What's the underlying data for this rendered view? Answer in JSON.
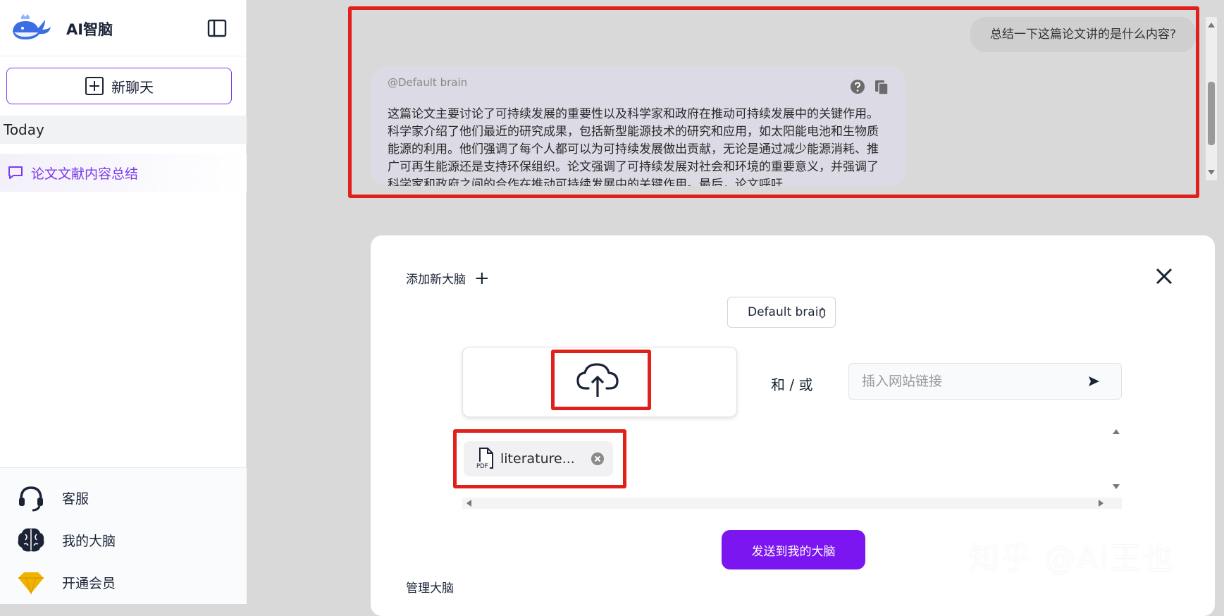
{
  "sidebar": {
    "app_name": "AI智脑",
    "new_chat_label": "新聊天",
    "section_label": "Today",
    "conversations": [
      {
        "label": "论文文献内容总结"
      }
    ],
    "footer": [
      {
        "label": "客服",
        "icon": "headset-icon"
      },
      {
        "label": "我的大脑",
        "icon": "brain-icon"
      },
      {
        "label": "开通会员",
        "icon": "diamond-icon"
      }
    ]
  },
  "chat": {
    "user_message": "总结一下这篇论文讲的是什么内容?",
    "assistant": {
      "brain_tag": "@Default brain",
      "answer": "这篇论文主要讨论了可持续发展的重要性以及科学家和政府在推动可持续发展中的关键作用。科学家介绍了他们最近的研究成果，包括新型能源技术的研究和应用，如太阳能电池和生物质能源的利用。他们强调了每个人都可以为可持续发展做出贡献，无论是通过减少能源消耗、推广可再生能源还是支持环保组织。论文强调了可持续发展对社会和环境的重要意义，并强调了科学家和政府之间的合作在推动可持续发展中的关键作用。最后，论文呼吁"
    }
  },
  "upload_panel": {
    "add_brain_label": "添加新大脑",
    "brain_select_value": "Default brain",
    "and_or_label": "和 / 或",
    "url_placeholder": "插入网站链接",
    "file_name": "literature...",
    "send_button_label": "发送到我的大脑",
    "manage_label": "管理大脑"
  },
  "watermark": "知乎 @AI王也",
  "colors": {
    "accent": "#7c3aed",
    "send_button": "#7c16f0",
    "highlight_box": "#e0201b",
    "assistant_bubble": "#dcdae4",
    "user_bubble": "#cfcfcf"
  }
}
